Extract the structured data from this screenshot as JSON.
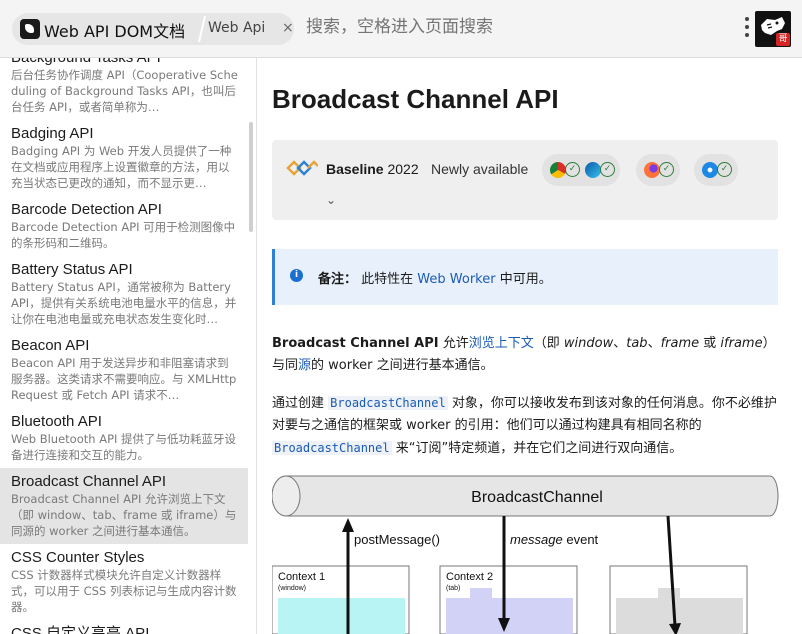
{
  "tab": {
    "title": "Web API DOM文档",
    "subtitle": "Web Api",
    "close": "×"
  },
  "search": {
    "placeholder": "搜索，空格进入页面搜索"
  },
  "avatar": {
    "badge": "哥"
  },
  "sidebar": {
    "items": [
      {
        "title": "Background Tasks API",
        "desc": "后台任务协作调度 API（Cooperative Scheduling of Background Tasks API，也叫后台任务 API，或者简单称为…"
      },
      {
        "title": "Badging API",
        "desc": "Badging API 为 Web 开发人员提供了一种在文档或应用程序上设置徽章的方法，用以充当状态已更改的通知，而不显示更…"
      },
      {
        "title": "Barcode Detection API",
        "desc": "Barcode Detection API 可用于检测图像中的条形码和二维码。"
      },
      {
        "title": "Battery Status API",
        "desc": "Battery Status API，通常被称为 Battery API，提供有关系统电池电量水平的信息，并让你在电池电量或充电状态发生变化时…"
      },
      {
        "title": "Beacon API",
        "desc": "Beacon API 用于发送异步和非阻塞请求到服务器。这类请求不需要响应。与 XMLHttpRequest 或 Fetch API 请求不…"
      },
      {
        "title": "Bluetooth API",
        "desc": "Web Bluetooth API 提供了与低功耗蓝牙设备进行连接和交互的能力。"
      },
      {
        "title": "Broadcast Channel API",
        "desc": "Broadcast Channel API 允许浏览上下文（即 window、tab、frame 或 iframe）与同源的 worker 之间进行基本通信。"
      },
      {
        "title": "CSS Counter Styles",
        "desc": "CSS 计数器样式模块允许自定义计数器样式，可以用于 CSS 列表标记与生成内容计数器。"
      },
      {
        "title": "CSS 自定义高亮 API",
        "desc": ""
      }
    ]
  },
  "main": {
    "title": "Broadcast Channel API",
    "baseline": {
      "label": "Baseline",
      "year": "2022",
      "status": "Newly available",
      "check": "✓",
      "chevron": "⌄"
    },
    "note": {
      "icon": "i",
      "label": "备注：",
      "text_before": "此特性在 ",
      "link": "Web Worker",
      "text_after": " 中可用。"
    },
    "p1": {
      "strong": "Broadcast Channel API",
      "t1": " 允许",
      "link1": "浏览上下文",
      "t2": "（即 ",
      "e1": "window",
      "t3": "、",
      "e2": "tab",
      "t4": "、",
      "e3": "frame",
      "t5": " 或 ",
      "e4": "iframe",
      "t6": "）与同",
      "link2": "源",
      "t7": "的 worker 之间进行基本通信。"
    },
    "p2": {
      "t1": "通过创建 ",
      "code1": "BroadcastChannel",
      "t2": " 对象，你可以接收发布到该对象的任何消息。你不必维护对要与之通信的框架或 worker 的引用：他们可以通过构建具有相同名称的 ",
      "code2": "BroadcastChannel",
      "t3": " 来“订阅”特定频道，并在它们之间进行双向通信。"
    },
    "diagram": {
      "channel": "BroadcastChannel",
      "post": "postMessage()",
      "event_em": "message",
      "event_rest": " event",
      "ctx1_title": "Context 1",
      "ctx1_sub": "(window)",
      "ctx2_title": "Context 2",
      "ctx2_sub": "(tab)"
    }
  },
  "colors": {
    "link": "#1a5bb5",
    "note_bg": "#e8f1fb",
    "baseline_bg": "#efefef",
    "active_item": "#e4e4e4"
  }
}
